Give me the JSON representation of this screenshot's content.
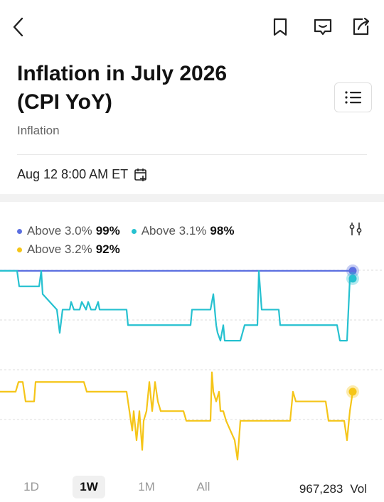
{
  "header": {
    "icons": [
      "back-icon",
      "bookmark-icon",
      "comment-icon",
      "share-icon"
    ]
  },
  "market": {
    "title_line1": "Inflation in July 2026",
    "title_line2": "(CPI YoY)",
    "category": "Inflation",
    "datetime": "Aug 12 8:00 AM ET"
  },
  "legend": {
    "items": [
      {
        "label": "Above 3.0%",
        "value": "99%",
        "color": "#5b6fe0"
      },
      {
        "label": "Above 3.1%",
        "value": "98%",
        "color": "#26c1d0"
      },
      {
        "label": "Above 3.2%",
        "value": "92%",
        "color": "#f5c518"
      }
    ]
  },
  "timeframes": {
    "options": [
      "1D",
      "1W",
      "1M",
      "All"
    ],
    "selected": "1W"
  },
  "volume": {
    "value": "967,283",
    "unit": "Vol"
  },
  "chart_data": {
    "type": "line",
    "x_label": "",
    "y_label": "",
    "series": [
      {
        "name": "Above 3.0%",
        "color": "#5b6fe0",
        "panel": "top",
        "y": [
          [
            0,
            99
          ],
          [
            496,
            99
          ]
        ]
      },
      {
        "name": "Above 3.1%",
        "color": "#26c1d0",
        "panel": "top",
        "y": [
          [
            0,
            99
          ],
          [
            24,
            99
          ],
          [
            27,
            97
          ],
          [
            55,
            97
          ],
          [
            58,
            99
          ],
          [
            60,
            96
          ],
          [
            80,
            94
          ],
          [
            84,
            91
          ],
          [
            88,
            94
          ],
          [
            98,
            94
          ],
          [
            100,
            95
          ],
          [
            104,
            94
          ],
          [
            112,
            94
          ],
          [
            115,
            95
          ],
          [
            121,
            94
          ],
          [
            124,
            95
          ],
          [
            128,
            94
          ],
          [
            134,
            94
          ],
          [
            138,
            95
          ],
          [
            140,
            94
          ],
          [
            178,
            94
          ],
          [
            180,
            92
          ],
          [
            268,
            92
          ],
          [
            270,
            94
          ],
          [
            296,
            94
          ],
          [
            300,
            96
          ],
          [
            304,
            92
          ],
          [
            306,
            91
          ],
          [
            310,
            90
          ],
          [
            314,
            92
          ],
          [
            316,
            90
          ],
          [
            338,
            90
          ],
          [
            344,
            92
          ],
          [
            362,
            92
          ],
          [
            364,
            99
          ],
          [
            368,
            94
          ],
          [
            392,
            94
          ],
          [
            394,
            92
          ],
          [
            474,
            92
          ],
          [
            478,
            90
          ],
          [
            488,
            90
          ],
          [
            492,
            98
          ]
        ]
      },
      {
        "name": "Above 3.2%",
        "color": "#f5c518",
        "panel": "bottom",
        "y": [
          [
            0,
            92
          ],
          [
            22,
            92
          ],
          [
            26,
            93
          ],
          [
            32,
            93
          ],
          [
            36,
            91
          ],
          [
            48,
            91
          ],
          [
            50,
            93
          ],
          [
            118,
            93
          ],
          [
            122,
            92
          ],
          [
            178,
            92
          ],
          [
            182,
            90
          ],
          [
            186,
            88
          ],
          [
            188,
            90
          ],
          [
            192,
            87
          ],
          [
            196,
            90
          ],
          [
            200,
            86
          ],
          [
            202,
            89
          ],
          [
            206,
            90
          ],
          [
            210,
            93
          ],
          [
            214,
            90
          ],
          [
            218,
            93
          ],
          [
            222,
            91
          ],
          [
            226,
            90
          ],
          [
            258,
            90
          ],
          [
            262,
            89
          ],
          [
            296,
            89
          ],
          [
            298,
            94
          ],
          [
            300,
            92
          ],
          [
            304,
            91
          ],
          [
            308,
            92
          ],
          [
            310,
            90
          ],
          [
            314,
            90
          ],
          [
            318,
            89
          ],
          [
            324,
            88
          ],
          [
            330,
            87
          ],
          [
            334,
            85
          ],
          [
            338,
            89
          ],
          [
            408,
            89
          ],
          [
            412,
            92
          ],
          [
            416,
            91
          ],
          [
            458,
            91
          ],
          [
            462,
            89
          ],
          [
            484,
            89
          ],
          [
            488,
            87
          ],
          [
            492,
            90
          ],
          [
            496,
            92
          ]
        ]
      }
    ]
  }
}
